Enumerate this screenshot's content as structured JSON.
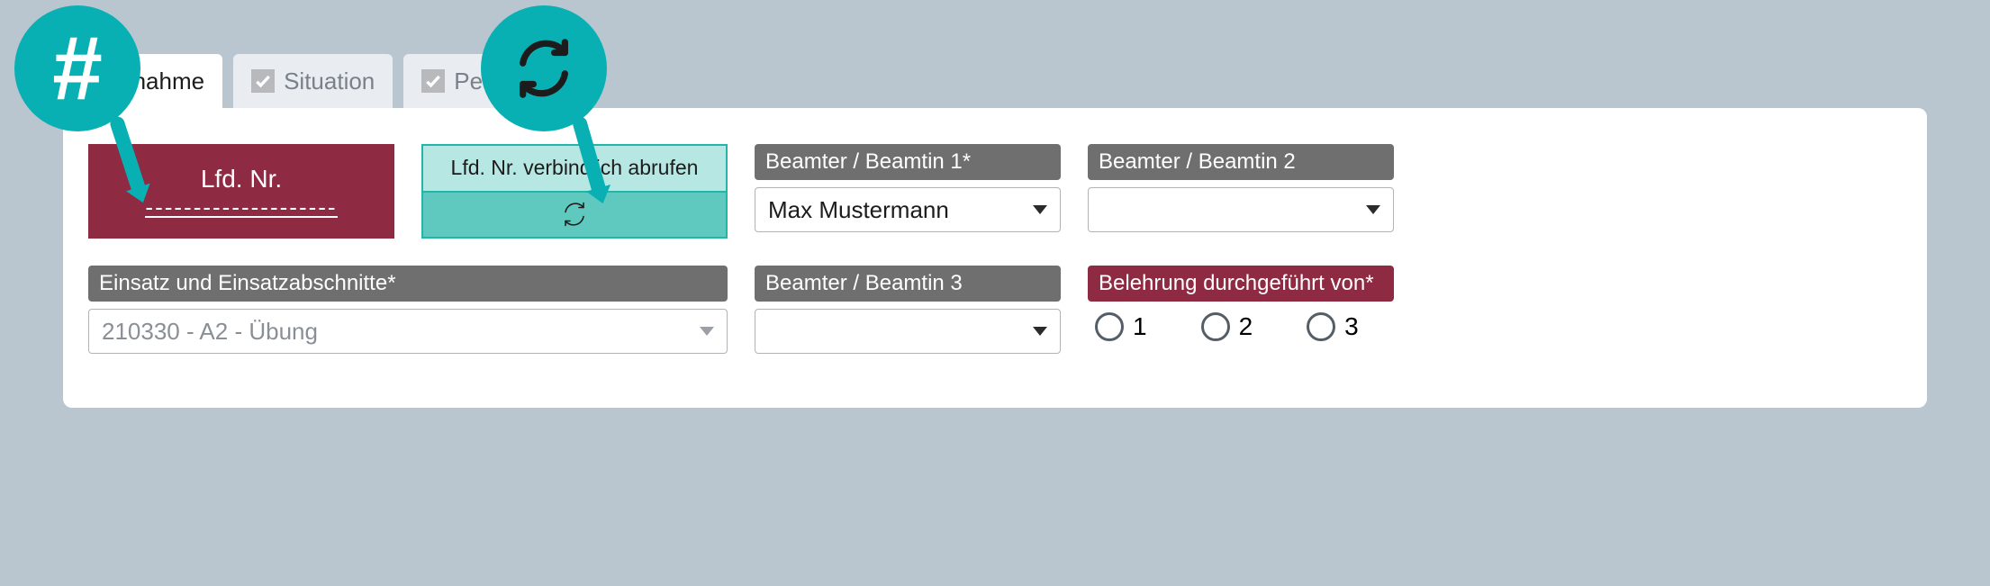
{
  "callouts": {
    "hash_symbol": "#"
  },
  "tabs": {
    "take": "bernahme",
    "situation": "Situation",
    "person": "Person"
  },
  "panel": {
    "lfdnr": {
      "title": "Lfd. Nr.",
      "placeholder": "--------------------"
    },
    "fetch_button": "Lfd. Nr. verbindlich abrufen",
    "officer1": {
      "label": "Beamter / Beamtin 1*",
      "value": "Max Mustermann"
    },
    "officer2": {
      "label": "Beamter / Beamtin 2",
      "value": ""
    },
    "mission": {
      "label": "Einsatz und Einsatzabschnitte*",
      "value": "210330 - A2 - Übung"
    },
    "officer3": {
      "label": "Beamter / Beamtin 3",
      "value": ""
    },
    "instruction": {
      "label": "Belehrung durchgeführt von*",
      "options": [
        "1",
        "2",
        "3"
      ]
    }
  }
}
